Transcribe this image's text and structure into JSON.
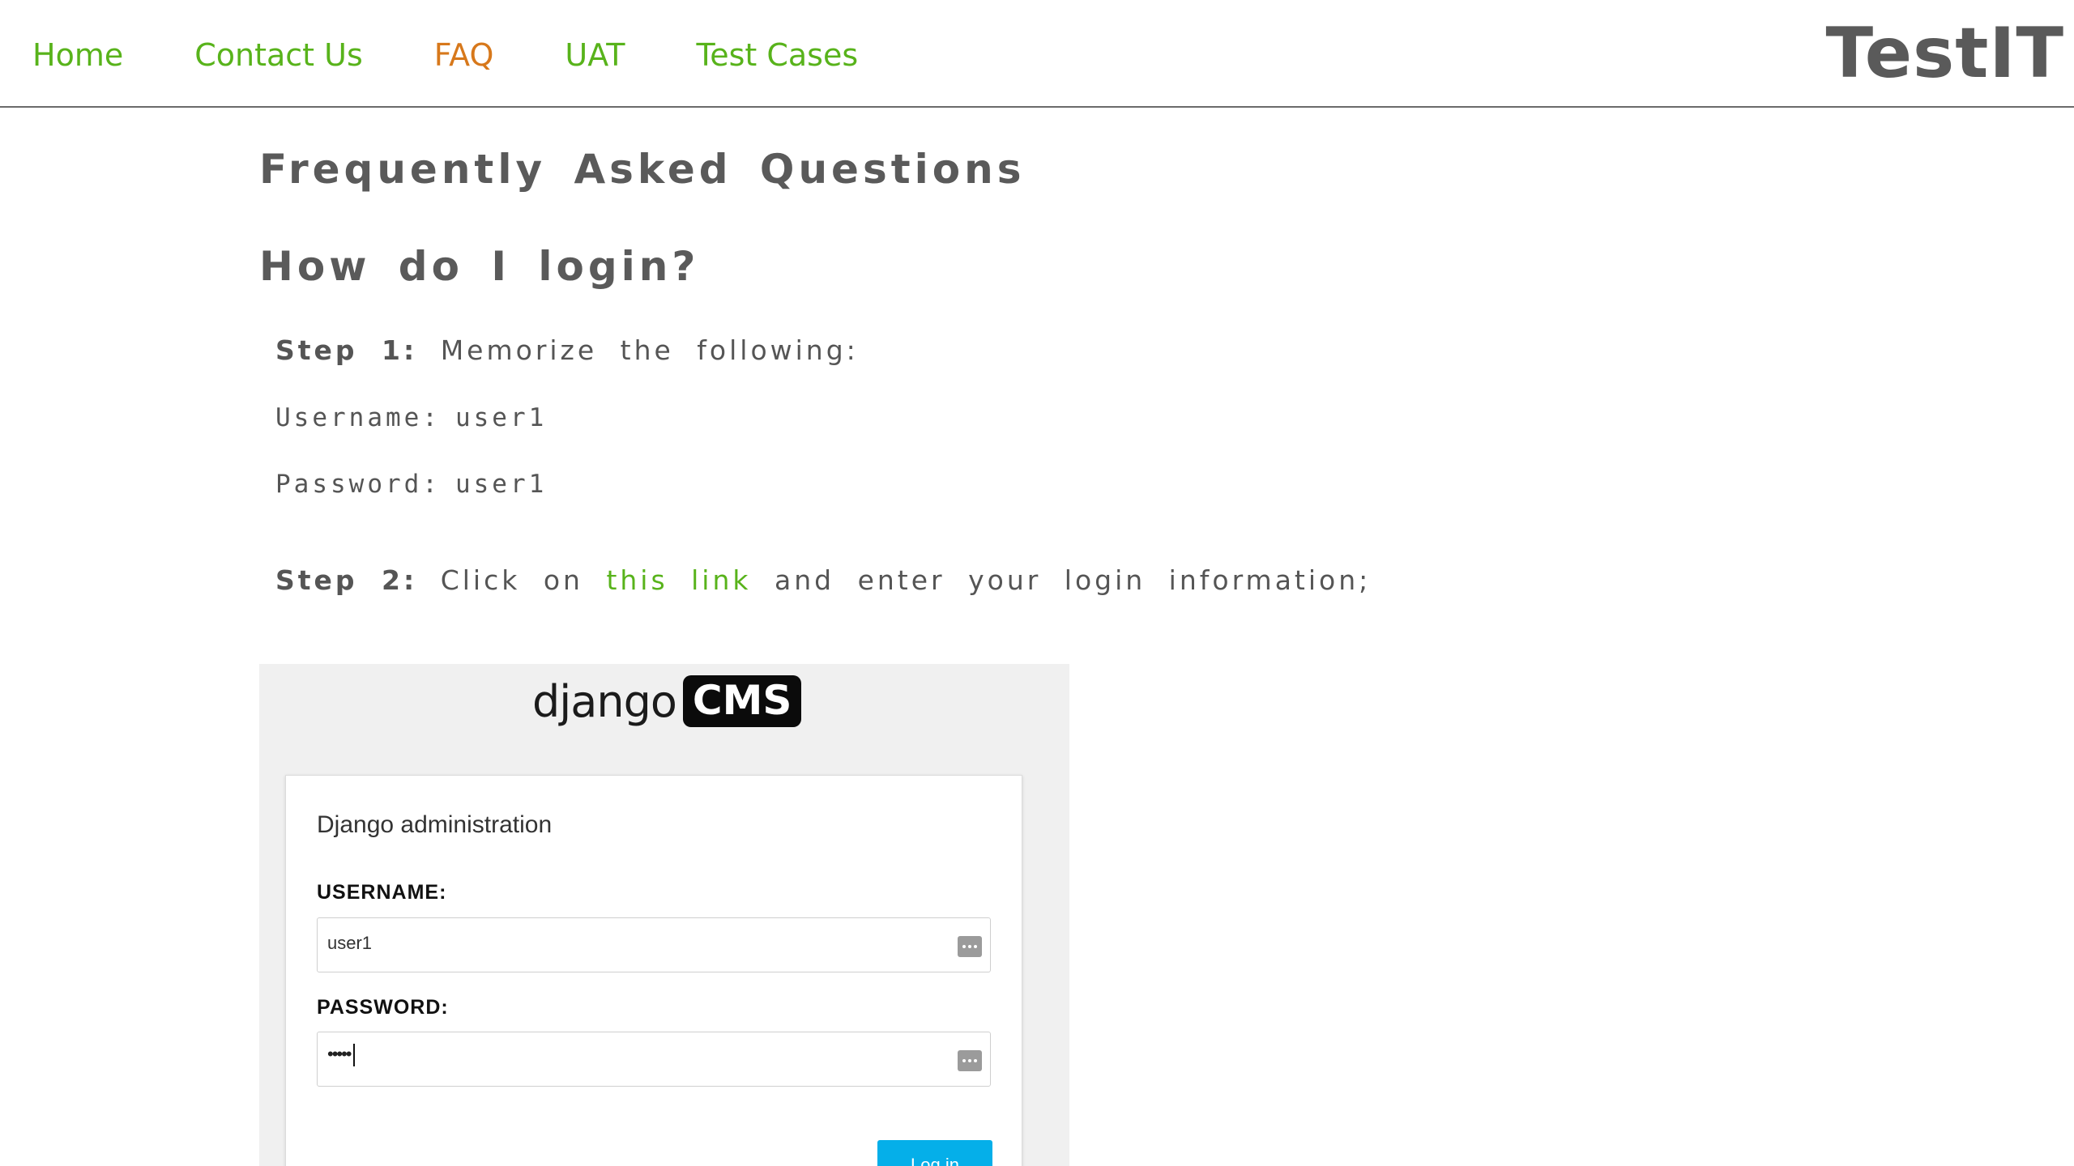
{
  "nav": {
    "items": [
      {
        "label": "Home"
      },
      {
        "label": "Contact Us"
      },
      {
        "label": "FAQ"
      },
      {
        "label": "UAT"
      },
      {
        "label": "Test Cases"
      }
    ],
    "active_index": 2
  },
  "brand": {
    "title": "TestIT"
  },
  "faq": {
    "page_title": "Frequently Asked Questions",
    "question": "How do I login?",
    "step1": {
      "label": "Step 1:",
      "text": "Memorize the following:"
    },
    "username": {
      "label": "Username:",
      "value": "user1"
    },
    "password": {
      "label": "Password:",
      "value": "user1"
    },
    "step2": {
      "label": "Step 2:",
      "text_before": "Click on",
      "link_text": "this link",
      "text_after": "and enter your login information;"
    }
  },
  "screenshot": {
    "logo_text": "django",
    "logo_badge": "CMS",
    "login_title": "Django administration",
    "username_label": "USERNAME:",
    "username_value": "user1",
    "password_label": "PASSWORD:",
    "password_value": "•••••",
    "login_button": "Log in"
  },
  "colors": {
    "nav_link": "#58b31b",
    "nav_active": "#d7781b",
    "text_gray": "#555555",
    "login_button": "#05afe9"
  }
}
